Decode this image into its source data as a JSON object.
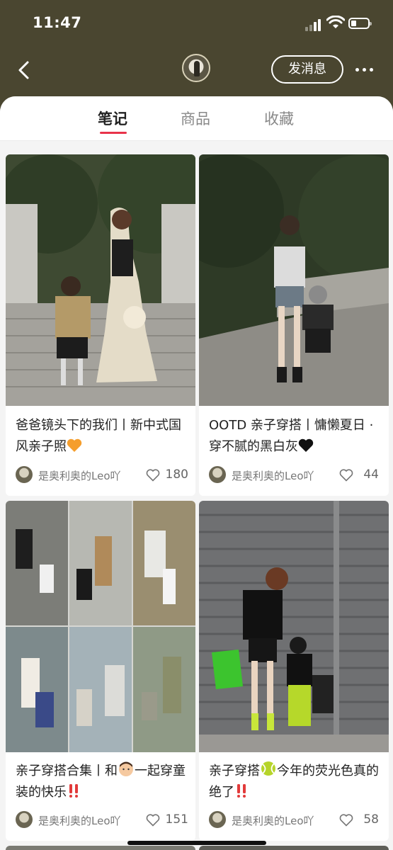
{
  "status": {
    "time": "11:47"
  },
  "nav": {
    "message_label": "发消息"
  },
  "tabs": [
    {
      "label": "笔记",
      "active": true
    },
    {
      "label": "商品",
      "active": false
    },
    {
      "label": "收藏",
      "active": false
    }
  ],
  "accent": "#e8334a",
  "notes": [
    {
      "title": "爸爸镜头下的我们丨新中式国风亲子照",
      "title_emoji": "orange-heart-icon",
      "author": "是奥利奥的Leo吖",
      "likes": "180"
    },
    {
      "title": "OOTD 亲子穿搭丨慵懒夏日 · 穿不腻的黑白灰",
      "title_emoji": "black-heart-icon",
      "author": "是奥利奥的Leo吖",
      "likes": "44"
    },
    {
      "title_a": "亲子穿搭合集丨和",
      "title_b": "一起穿童装的快乐",
      "title_emoji": "boy-face-icon",
      "title_emoji2": "double-exclamation-icon",
      "author": "是奥利奥的Leo吖",
      "likes": "151"
    },
    {
      "title_a": "亲子穿搭",
      "title_b": "今年的荧光色真的绝了",
      "title_emoji": "tennis-ball-icon",
      "title_emoji2": "double-exclamation-icon",
      "author": "是奥利奥的Leo吖",
      "likes": "58"
    }
  ]
}
